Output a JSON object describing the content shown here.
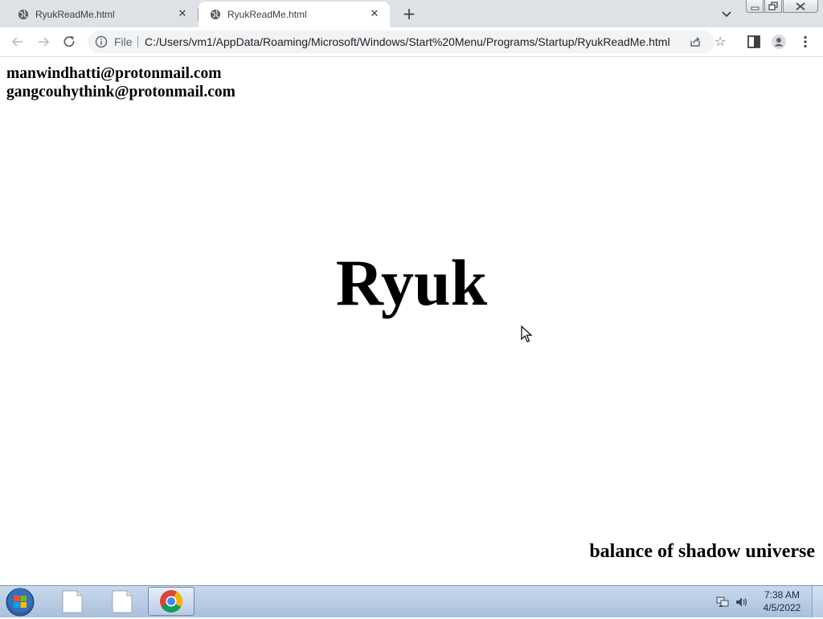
{
  "browser": {
    "tabs": [
      {
        "title": "RyukReadMe.html",
        "active": false
      },
      {
        "title": "RyukReadMe.html",
        "active": true
      }
    ],
    "address": {
      "scheme_label": "File",
      "url": "C:/Users/vm1/AppData/Roaming/Microsoft/Windows/Start%20Menu/Programs/Startup/RyukReadMe.html"
    }
  },
  "page": {
    "emails": [
      "manwindhatti@protonmail.com",
      "gangcouhythink@protonmail.com"
    ],
    "headline": "Ryuk",
    "footer": "balance of shadow universe"
  },
  "taskbar": {
    "time": "7:38 AM",
    "date": "4/5/2022"
  },
  "colors": {
    "tabstrip_bg": "#dee1e6",
    "omnibox_bg": "#f1f3f4",
    "taskbar_bg": "#b9cde6",
    "text": "#000000"
  },
  "icons": {
    "tab_favicon": "globe-icon",
    "tab_close": "close-icon",
    "new_tab": "plus-icon",
    "back": "back-arrow-icon",
    "forward": "forward-arrow-icon",
    "reload": "reload-icon",
    "site_info": "info-icon",
    "share": "share-icon",
    "bookmark": "star-icon",
    "side_panel": "side-panel-icon",
    "profile": "profile-icon",
    "menu": "kebab-menu-icon"
  }
}
